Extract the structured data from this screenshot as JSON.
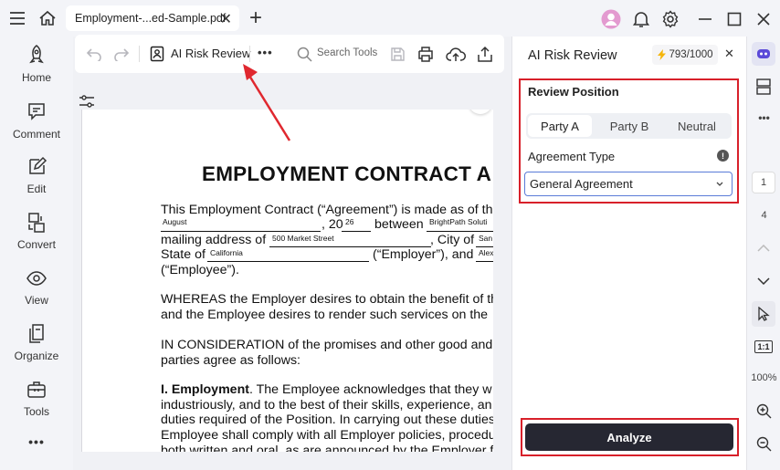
{
  "titlebar": {
    "tab_title": "Employment-...ed-Sample.pdf",
    "close_tab": "✕",
    "new_tab": "+"
  },
  "leftnav": {
    "items": [
      {
        "label": "Home",
        "icon": "rocket-icon"
      },
      {
        "label": "Comment",
        "icon": "comment-icon"
      },
      {
        "label": "Edit",
        "icon": "edit-icon"
      },
      {
        "label": "Convert",
        "icon": "convert-icon"
      },
      {
        "label": "View",
        "icon": "eye-icon"
      },
      {
        "label": "Organize",
        "icon": "organize-icon"
      },
      {
        "label": "Tools",
        "icon": "toolbox-icon"
      }
    ],
    "more": "•••"
  },
  "toolbar": {
    "ai_risk_label": "AI Risk Review",
    "more": "•••",
    "search_placeholder": "Search Tools"
  },
  "document": {
    "heading": "EMPLOYMENT CONTRACT A",
    "line1": "This Employment Contract (“Agreement”) is made as of th",
    "line2_comma": ", 20",
    "line2_between": "between",
    "line3_a": "mailing address of",
    "line3_b": ", City of",
    "line4_a": "State of",
    "line4_b": "(“Employer”), and",
    "line5": "(“Employee”).",
    "whereas1": "WHEREAS the Employer desires to obtain the benefit of th",
    "whereas2": "and the Employee desires to render such services on the",
    "consideration1": "IN CONSIDERATION of the promises and other good and",
    "consideration2": "parties agree as follows:",
    "employment_bold": "I. Employment",
    "employment1": ". The Employee acknowledges that they w",
    "employment2": "industriously, and to the best of their skills, experience, an",
    "employment3": "duties required of the Position. In carrying out these duties",
    "employment4": "Employee shall comply with all Employer policies, procedu",
    "employment5": "both written and oral, as are announced by the Employer f",
    "fill_month": "August",
    "fill_year": "26",
    "fill_company": "BrightPath Soluti",
    "fill_address": "500 Market Street",
    "fill_city": "San",
    "fill_state": "California",
    "fill_employee": "Alex"
  },
  "panel": {
    "title": "AI Risk Review",
    "credits": "793/1000",
    "close": "✕",
    "review_position_label": "Review Position",
    "positions": [
      "Party A",
      "Party B",
      "Neutral"
    ],
    "selected_position": "Party A",
    "agreement_type_label": "Agreement Type",
    "info": "!",
    "agreement_type_value": "General Agreement",
    "analyze_label": "Analyze"
  },
  "rightbar": {
    "page_current": "1",
    "page_total": "4",
    "fit_label": "1:1",
    "zoom": "100%",
    "more": "•••"
  },
  "colors": {
    "highlight_red": "#d8202a",
    "analyze_bg": "#262732",
    "accent_blue": "#5a7bd8"
  }
}
